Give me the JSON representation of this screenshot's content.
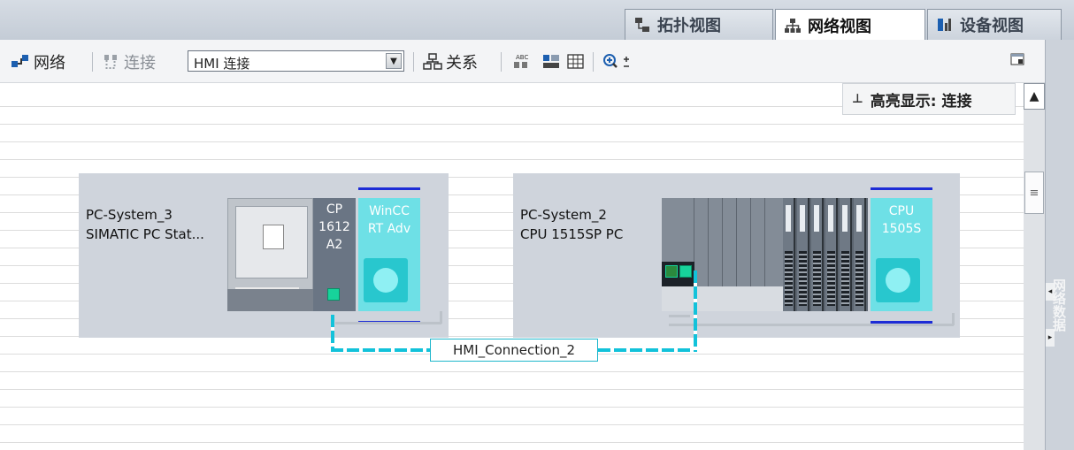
{
  "tabs": [
    {
      "label": "拓扑视图",
      "icon": "topology-icon",
      "active": false
    },
    {
      "label": "网络视图",
      "icon": "network-view-icon",
      "active": true
    },
    {
      "label": "设备视图",
      "icon": "device-view-icon",
      "active": false
    }
  ],
  "toolbar": {
    "network_label": "网络",
    "connections_label": "连接",
    "connection_type": "HMI 连接",
    "relations_label": "关系"
  },
  "canvas": {
    "highlight_label": "高亮显示: 连接",
    "stations": [
      {
        "name": "PC-System_3",
        "type": "SIMATIC PC Stat...",
        "cp_label": [
          "CP",
          "1612",
          "A2"
        ],
        "hmi_label": [
          "WinCC",
          "RT Adv"
        ]
      },
      {
        "name": "PC-System_2",
        "type": "CPU 1515SP PC",
        "cpu_label": [
          "CPU",
          "1505S"
        ]
      }
    ],
    "connection_name": "HMI_Connection_2"
  },
  "side_panel": {
    "label": "网络数据"
  },
  "colors": {
    "hmi_connection": "#12c2da",
    "port": "#17d39b",
    "hmi_module": "#6ee0e6",
    "station_bg": "#cfd4dc"
  }
}
